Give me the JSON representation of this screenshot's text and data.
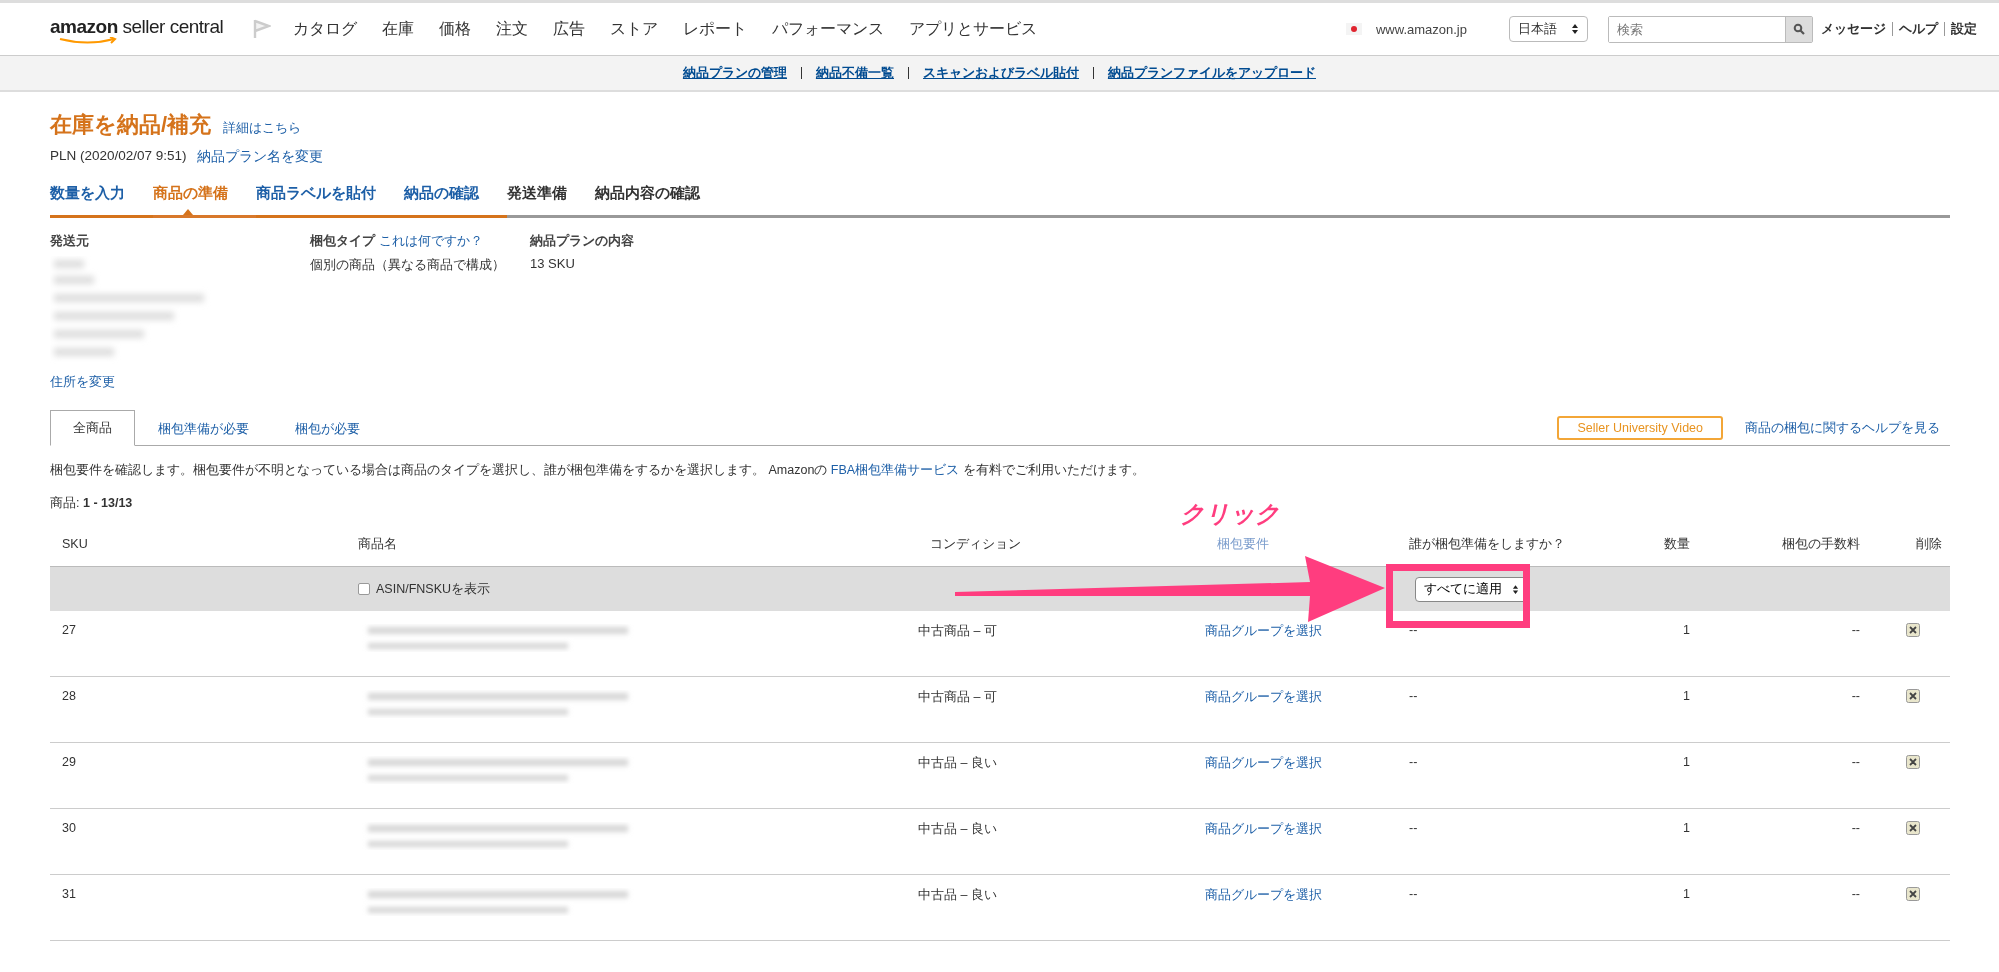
{
  "header": {
    "logo": "amazon seller central",
    "nav": [
      "カタログ",
      "在庫",
      "価格",
      "注文",
      "広告",
      "ストア",
      "レポート",
      "パフォーマンス",
      "アプリとサービス"
    ],
    "marketplace": "www.amazon.jp",
    "language": "日本語",
    "search": {
      "placeholder": "検索"
    },
    "links": [
      "メッセージ",
      "ヘルプ",
      "設定"
    ]
  },
  "subnav": [
    "納品プランの管理",
    "納品不備一覧",
    "スキャンおよびラベル貼付",
    "納品プランファイルをアップロード"
  ],
  "page": {
    "title": "在庫を納品/補充",
    "title_link": "詳細はこちら",
    "plan": "PLN (2020/02/07 9:51)",
    "rename_link": "納品プラン名を変更"
  },
  "steps": [
    {
      "label": "数量を入力",
      "selected": false,
      "completed": true
    },
    {
      "label": "商品の準備",
      "selected": true,
      "completed": false
    },
    {
      "label": "商品ラベルを貼付",
      "selected": false,
      "completed": true
    },
    {
      "label": "納品の確認",
      "selected": false,
      "completed": true
    },
    {
      "label": "発送準備",
      "selected": false,
      "completed": false
    },
    {
      "label": "納品内容の確認",
      "selected": false,
      "completed": false
    }
  ],
  "ship_from": {
    "label": "発送元",
    "change_link": "住所を変更"
  },
  "packing_type": {
    "label": "梱包タイプ",
    "help_link": "これは何ですか？",
    "value": "個別の商品（異なる商品で構成）"
  },
  "contents": {
    "label": "納品プランの内容",
    "value": "13 SKU"
  },
  "filter_tabs": [
    {
      "label": "全商品",
      "selected": true
    },
    {
      "label": "梱包準備が必要",
      "selected": false
    },
    {
      "label": "梱包が必要",
      "selected": false
    }
  ],
  "video_button": "Seller University Video",
  "help_link": "商品の梱包に関するヘルプを見る",
  "description": {
    "before": "梱包要件を確認します。梱包要件が不明となっている場合は商品のタイプを選択し、誰が梱包準備をするかを選択します。 Amazonの ",
    "link": "FBA梱包準備サービス",
    "after": " を有料でご利用いただけます。"
  },
  "count": "商品: **1 - 13/13**",
  "table": {
    "columns": [
      "SKU",
      "商品名",
      "コンディション",
      "梱包要件",
      "誰が梱包準備をしますか？",
      "数量",
      "梱包の手数料",
      "削除"
    ],
    "show_asin": {
      "label": "ASIN/FNSKUを表示",
      "checked": false
    },
    "apply_all": "すべてに適用",
    "rows": [
      {
        "sku": "27",
        "condition": "中古商品 – 可",
        "prep": "商品グループを選択",
        "who": "--",
        "quantity": "1",
        "fee": "--"
      },
      {
        "sku": "28",
        "condition": "中古商品 – 可",
        "prep": "商品グループを選択",
        "who": "--",
        "quantity": "1",
        "fee": "--"
      },
      {
        "sku": "29",
        "condition": "中古品 – 良い",
        "prep": "商品グループを選択",
        "who": "--",
        "quantity": "1",
        "fee": "--"
      },
      {
        "sku": "30",
        "condition": "中古品 – 良い",
        "prep": "商品グループを選択",
        "who": "--",
        "quantity": "1",
        "fee": "--"
      },
      {
        "sku": "31",
        "condition": "中古品 – 良い",
        "prep": "商品グループを選択",
        "who": "--",
        "quantity": "1",
        "fee": "--"
      }
    ]
  },
  "annotation": {
    "label": "クリック"
  }
}
